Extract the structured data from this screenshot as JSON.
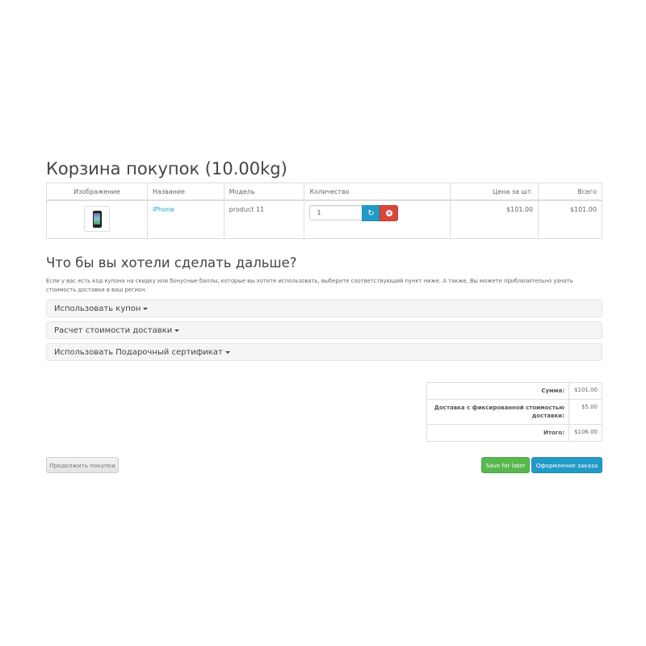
{
  "page_title": "Корзина покупок  (10.00kg)",
  "cart": {
    "headers": {
      "image": "Изображение",
      "name": "Название",
      "model": "Модель",
      "quantity": "Количество",
      "unit_price": "Цена за шт.",
      "total": "Всего"
    },
    "items": [
      {
        "name": "iPhone",
        "model": "product 11",
        "quantity": "1",
        "unit_price": "$101.00",
        "total": "$101.00"
      }
    ]
  },
  "next": {
    "title": "Что бы вы хотели сделать дальше?",
    "description": "Если у вас есть код купона на скидку или бонусные баллы, которые вы хотите использовать, выберите соответствующий пункт ниже. А также, Вы можете приблизительно узнать стоимость доставки в ваш регион.",
    "panels": [
      "Использовать купон",
      "Расчет стоимости доставки",
      "Использовать Подарочный сертификат"
    ]
  },
  "totals": [
    {
      "label": "Сумма:",
      "value": "$101.00"
    },
    {
      "label": "Доставка с фиксированной стоимостью доставки:",
      "value": "$5.00"
    },
    {
      "label": "Итого:",
      "value": "$106.00"
    }
  ],
  "buttons": {
    "continue": "Продолжить покупки",
    "save_later": "Save for later",
    "checkout": "Оформление заказа"
  },
  "icons": {
    "refresh": "refresh-icon",
    "remove": "remove-icon"
  },
  "colors": {
    "link": "#23a1d1",
    "primary": "#229ac8",
    "danger": "#d9463c",
    "success": "#58b74f"
  }
}
